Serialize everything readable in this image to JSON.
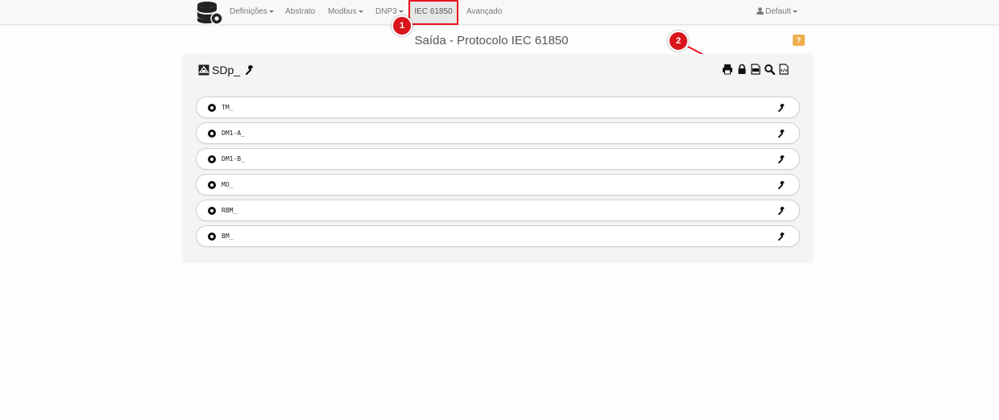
{
  "nav": {
    "items": [
      {
        "label": "Definições",
        "caret": true
      },
      {
        "label": "Abstrato",
        "caret": false
      },
      {
        "label": "Modbus",
        "caret": true
      },
      {
        "label": "DNP3",
        "caret": true
      },
      {
        "label": "IEC 61850",
        "caret": false,
        "active": true
      },
      {
        "label": "Avançado",
        "caret": false
      }
    ],
    "user": "Default"
  },
  "page": {
    "title": "Saída - Protocolo IEC 61850",
    "help_label": "?"
  },
  "panel": {
    "title": "SDp_",
    "toolbar_icons": [
      "print-icon",
      "lock-icon",
      "xml-file-icon",
      "search-icon",
      "code-file-icon"
    ],
    "rows": [
      {
        "label": "TM_"
      },
      {
        "label": "DM1-A_"
      },
      {
        "label": "DM1-B_"
      },
      {
        "label": "MO_"
      },
      {
        "label": "RBM_"
      },
      {
        "label": "BM_"
      }
    ]
  },
  "annotations": {
    "badge1": "1",
    "badge2": "2",
    "accent_color": "#e8111d"
  }
}
